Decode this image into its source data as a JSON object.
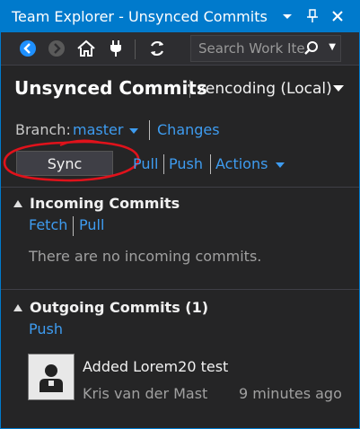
{
  "window": {
    "title": "Team Explorer - Unsynced Commits",
    "controls": [
      "chevron-down-icon",
      "pin-icon",
      "close-icon"
    ]
  },
  "toolbar": {
    "buttons": [
      "back-icon",
      "forward-icon",
      "home-icon",
      "connect-icon",
      "refresh-icon"
    ],
    "search_placeholder": "Search Work Items"
  },
  "page": {
    "title": "Unsynced Commits",
    "context": "zencoding (Local)"
  },
  "branch": {
    "label": "Branch:",
    "value": "master",
    "changes_link": "Changes"
  },
  "sync_row": {
    "sync_label": "Sync",
    "pull_label": "Pull",
    "push_label": "Push",
    "actions_label": "Actions"
  },
  "incoming": {
    "title": "Incoming Commits",
    "fetch_label": "Fetch",
    "pull_label": "Pull",
    "empty_message": "There are no incoming commits."
  },
  "outgoing": {
    "title": "Outgoing Commits (1)",
    "push_label": "Push",
    "commits": [
      {
        "message": "Added Lorem20 test",
        "author": "Kris van der Mast",
        "time": "9 minutes ago"
      }
    ]
  },
  "colors": {
    "accent": "#007acc",
    "link": "#3e9cf0",
    "background": "#252526",
    "annotation_circle": "#e0121b"
  }
}
